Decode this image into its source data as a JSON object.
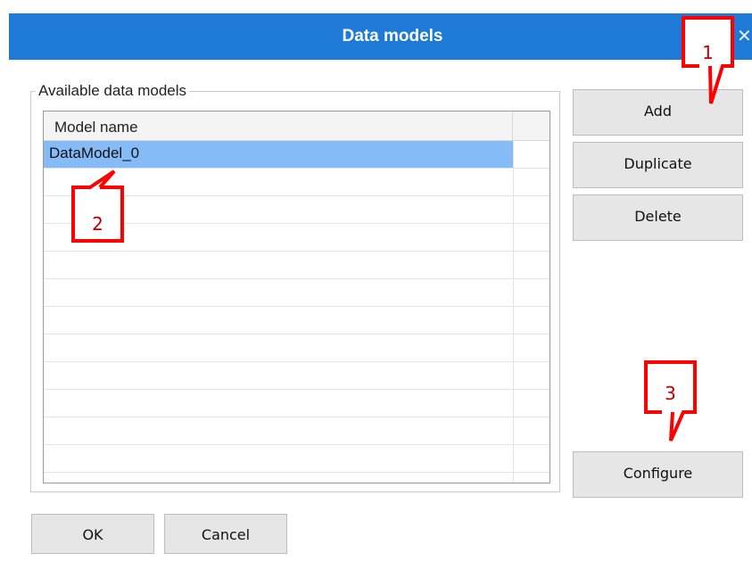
{
  "window": {
    "title": "Data models",
    "close_glyph": "✕"
  },
  "group": {
    "legend": "Available data models"
  },
  "grid": {
    "column_header": "Model name",
    "rows": [
      "DataModel_0"
    ],
    "selected_row": 0
  },
  "buttons": {
    "add": "Add",
    "duplicate": "Duplicate",
    "delete": "Delete",
    "configure": "Configure",
    "ok": "OK",
    "cancel": "Cancel"
  },
  "callouts": {
    "one": "1",
    "two": "2",
    "three": "3"
  },
  "colors": {
    "titlebar": "#1e7ad6",
    "selection": "#85bbf7",
    "callout": "#ff0000"
  },
  "icons": {
    "close": "close-icon"
  }
}
